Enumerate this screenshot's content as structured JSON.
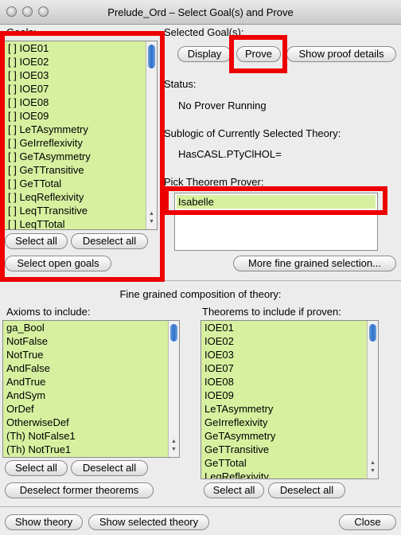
{
  "window": {
    "title": "Prelude_Ord – Select Goal(s) and Prove"
  },
  "goals": {
    "label": "Goals:",
    "items": [
      "[ ] IOE01",
      "[ ] IOE02",
      "[ ] IOE03",
      "[ ] IOE07",
      "[ ] IOE08",
      "[ ] IOE09",
      "[ ] LeTAsymmetry",
      "[ ] GeIrreflexivity",
      "[ ] GeTAsymmetry",
      "[ ] GeTTransitive",
      "[ ] GeTTotal",
      "[ ] LeqReflexivity",
      "[ ] LeqTTransitive",
      "[ ] LeqTTotal"
    ],
    "select_all": "Select all",
    "deselect_all": "Deselect all",
    "select_open": "Select open goals"
  },
  "selected_goals": {
    "label": "Selected Goal(s):",
    "display": "Display",
    "prove": "Prove",
    "show_details": "Show proof details"
  },
  "status": {
    "label": "Status:",
    "value": "No Prover Running"
  },
  "sublogic": {
    "label": "Sublogic of Currently Selected Theory:",
    "value": "HasCASL.PTyClHOL="
  },
  "prover": {
    "label": "Pick Theorem Prover:",
    "items": [
      "Isabelle"
    ],
    "more": "More fine grained selection..."
  },
  "composition": {
    "title": "Fine grained composition of theory:"
  },
  "axioms": {
    "label": "Axioms to include:",
    "items": [
      "ga_Bool",
      "NotFalse",
      "NotTrue",
      "AndFalse",
      "AndTrue",
      "AndSym",
      "OrDef",
      "OtherwiseDef",
      "(Th) NotFalse1",
      "(Th) NotTrue1"
    ],
    "select_all": "Select all",
    "deselect_all": "Deselect all",
    "deselect_former": "Deselect former theorems"
  },
  "theorems": {
    "label": "Theorems to include if proven:",
    "items": [
      "IOE01",
      "IOE02",
      "IOE03",
      "IOE07",
      "IOE08",
      "IOE09",
      "LeTAsymmetry",
      "GeIrreflexivity",
      "GeTAsymmetry",
      "GeTTransitive",
      "GeTTotal",
      "LeqReflexivity"
    ],
    "select_all": "Select all",
    "deselect_all": "Deselect all"
  },
  "footer": {
    "show_theory": "Show theory",
    "show_selected": "Show selected theory",
    "close": "Close"
  },
  "colors": {
    "list_bg": "#d7f0a0",
    "highlight_box": "#ee0000",
    "scroll_thumb": "#2f6fc8"
  }
}
